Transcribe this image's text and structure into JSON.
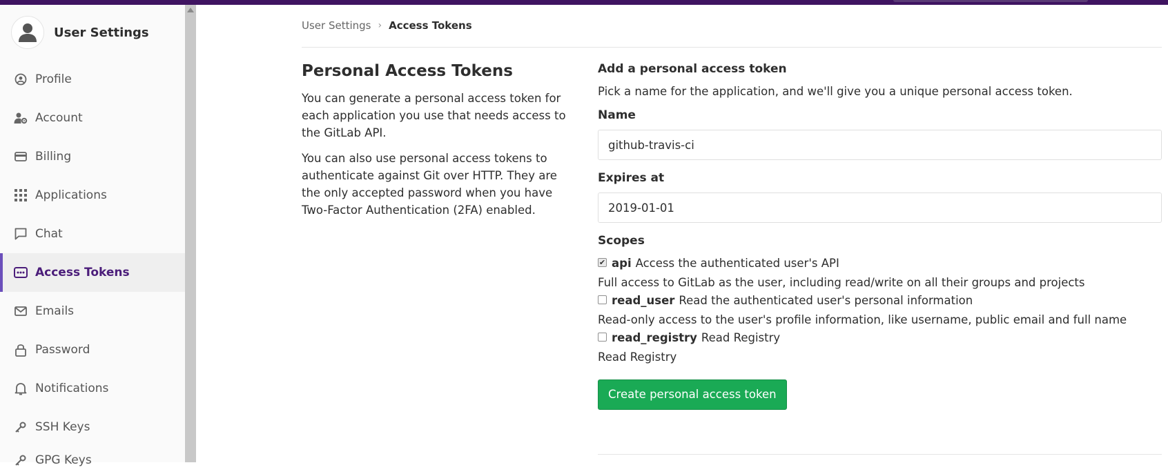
{
  "sidebar": {
    "title": "User Settings",
    "items": [
      {
        "label": "Profile",
        "icon": "profile-icon",
        "active": false
      },
      {
        "label": "Account",
        "icon": "account-icon",
        "active": false
      },
      {
        "label": "Billing",
        "icon": "billing-icon",
        "active": false
      },
      {
        "label": "Applications",
        "icon": "applications-icon",
        "active": false
      },
      {
        "label": "Chat",
        "icon": "chat-icon",
        "active": false
      },
      {
        "label": "Access Tokens",
        "icon": "access-tokens-icon",
        "active": true
      },
      {
        "label": "Emails",
        "icon": "emails-icon",
        "active": false
      },
      {
        "label": "Password",
        "icon": "lock-icon",
        "active": false
      },
      {
        "label": "Notifications",
        "icon": "bell-icon",
        "active": false
      },
      {
        "label": "SSH Keys",
        "icon": "key-icon",
        "active": false
      },
      {
        "label": "GPG Keys",
        "icon": "key-icon",
        "active": false
      }
    ]
  },
  "breadcrumb": {
    "parent": "User Settings",
    "separator": "›",
    "current": "Access Tokens"
  },
  "info": {
    "heading": "Personal Access Tokens",
    "paragraph1": "You can generate a personal access token for each application you use that needs access to the GitLab API.",
    "paragraph2": "You can also use personal access tokens to authenticate against Git over HTTP. They are the only accepted password when you have Two-Factor Authentication (2FA) enabled."
  },
  "form": {
    "title": "Add a personal access token",
    "intro": "Pick a name for the application, and we'll give you a unique personal access token.",
    "name_label": "Name",
    "name_value": "github-travis-ci",
    "expires_label": "Expires at",
    "expires_value": "2019-01-01",
    "scopes_label": "Scopes",
    "scopes": [
      {
        "name": "api",
        "title": "Access the authenticated user's API",
        "help": "Full access to GitLab as the user, including read/write on all their groups and projects",
        "checked": true
      },
      {
        "name": "read_user",
        "title": "Read the authenticated user's personal information",
        "help": "Read-only access to the user's profile information, like username, public email and full name",
        "checked": false
      },
      {
        "name": "read_registry",
        "title": "Read Registry",
        "help": "Read Registry",
        "checked": false
      }
    ],
    "submit_label": "Create personal access token"
  },
  "colors": {
    "topbar": "#3f1461",
    "accent": "#6b4fbb",
    "button": "#1aaa55"
  }
}
